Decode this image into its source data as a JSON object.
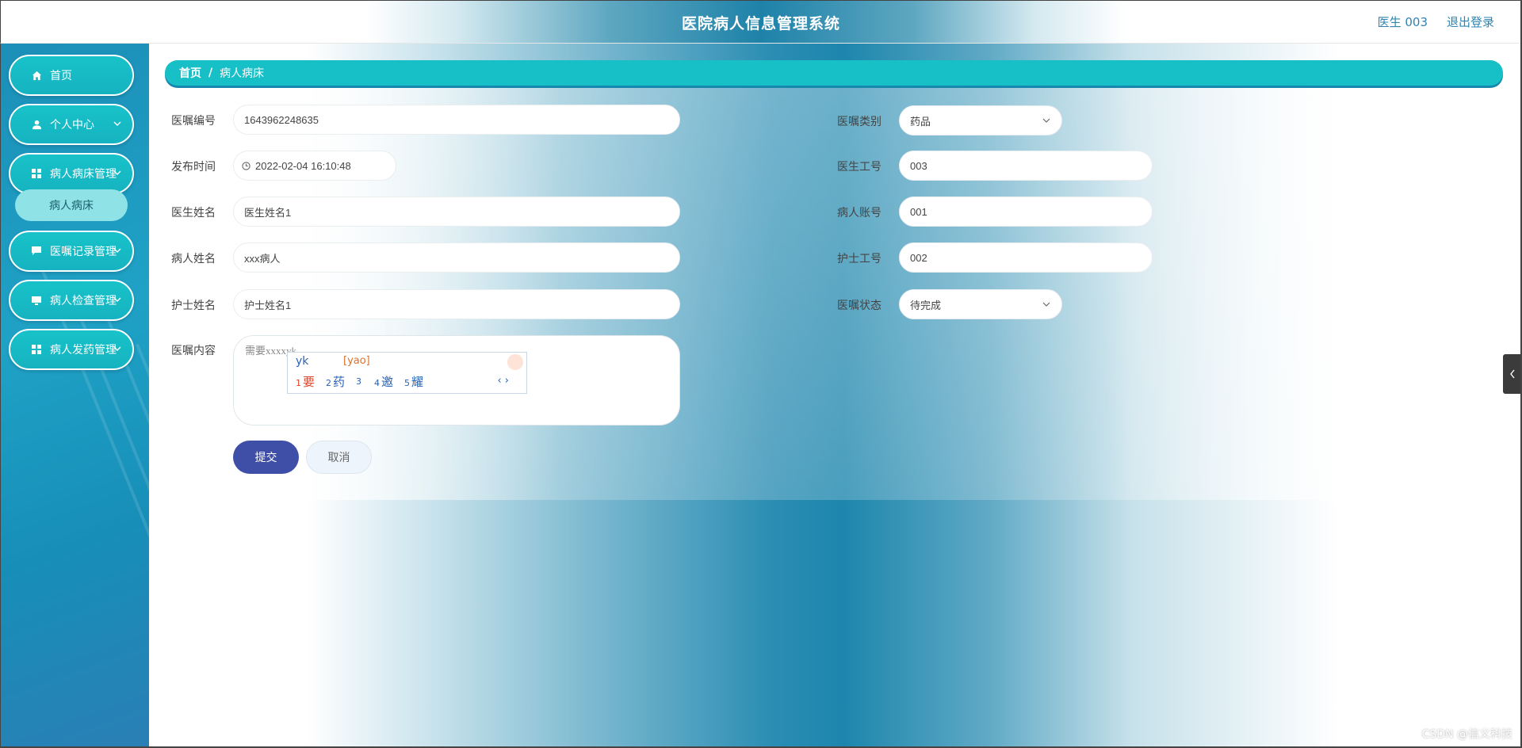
{
  "header": {
    "title": "医院病人信息管理系统",
    "user": "医生 003",
    "logout": "退出登录"
  },
  "sidebar": {
    "items": [
      {
        "label": "首页",
        "icon": "home-icon"
      },
      {
        "label": "个人中心",
        "icon": "user-icon"
      },
      {
        "label": "病人病床管理",
        "icon": "grid-icon"
      },
      {
        "label": "医嘱记录管理",
        "icon": "chat-icon"
      },
      {
        "label": "病人检查管理",
        "icon": "monitor-icon"
      },
      {
        "label": "病人发药管理",
        "icon": "grid-icon"
      }
    ],
    "submenu": {
      "label": "病人病床"
    }
  },
  "breadcrumb": {
    "home": "首页",
    "separator": "/",
    "current": "病人病床"
  },
  "form": {
    "order_no": {
      "label": "医嘱编号",
      "value": "1643962248635"
    },
    "publish_time": {
      "label": "发布时间",
      "value": "2022-02-04 16:10:48"
    },
    "doctor_name": {
      "label": "医生姓名",
      "value": "医生姓名1"
    },
    "patient_name": {
      "label": "病人姓名",
      "value": "xxx病人"
    },
    "nurse_name": {
      "label": "护士姓名",
      "value": "护士姓名1"
    },
    "order_content": {
      "label": "医嘱内容",
      "value": "需要xxxxyk"
    },
    "order_type": {
      "label": "医嘱类别",
      "value": "药品"
    },
    "doctor_id": {
      "label": "医生工号",
      "value": "003"
    },
    "patient_account": {
      "label": "病人账号",
      "value": "001"
    },
    "nurse_id": {
      "label": "护士工号",
      "value": "002"
    },
    "order_status": {
      "label": "医嘱状态",
      "value": "待完成"
    },
    "submit": "提交",
    "cancel": "取消"
  },
  "ime": {
    "composition": "yk",
    "pinyin": "[yao]",
    "candidates": [
      {
        "n": "1",
        "text": "要"
      },
      {
        "n": "2",
        "text": "药"
      },
      {
        "n": "3",
        "text": ""
      },
      {
        "n": "4",
        "text": "邀"
      },
      {
        "n": "5",
        "text": "耀"
      }
    ],
    "pager": "‹ ›"
  },
  "watermark": "CSDN @信义科技",
  "colors": {
    "accent": "#17bfc6",
    "primary_button": "#3f4fa7",
    "sidebar": "#1c8fb8"
  }
}
